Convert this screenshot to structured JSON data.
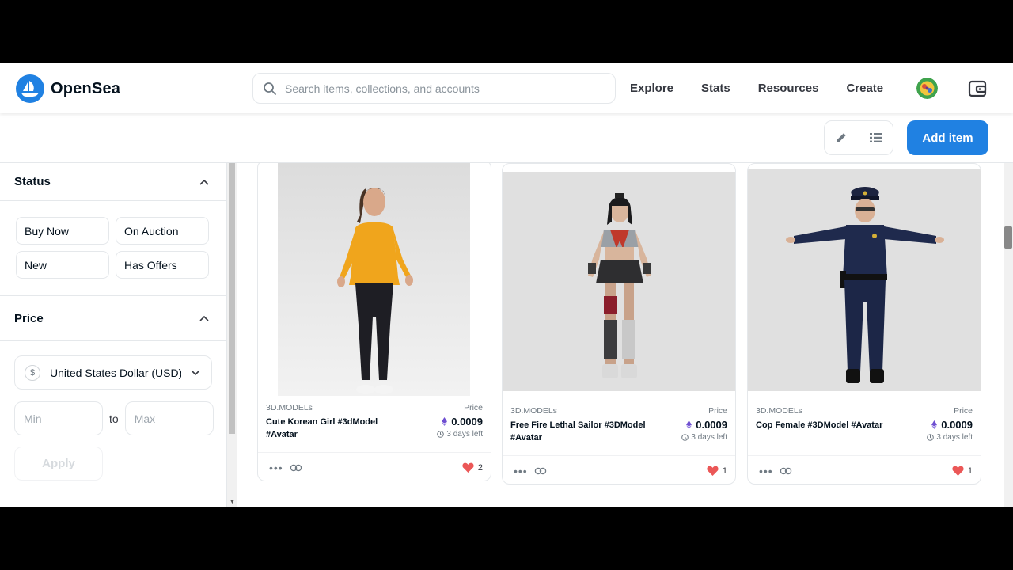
{
  "header": {
    "brand": "OpenSea",
    "search_placeholder": "Search items, collections, and accounts",
    "nav": [
      "Explore",
      "Stats",
      "Resources",
      "Create"
    ]
  },
  "actions": {
    "add_item": "Add item"
  },
  "sidebar": {
    "status_title": "Status",
    "status_options": [
      "Buy Now",
      "On Auction",
      "New",
      "Has Offers"
    ],
    "price_title": "Price",
    "currency": "United States Dollar (USD)",
    "currency_symbol": "$",
    "min_placeholder": "Min",
    "to_label": "to",
    "max_placeholder": "Max",
    "apply_label": "Apply"
  },
  "items": [
    {
      "collection": "3D.MODELs",
      "title": "Cute Korean Girl #3dModel #Avatar",
      "price_label": "Price",
      "price": "0.0009",
      "time_left": "3 days left",
      "likes": "2"
    },
    {
      "collection": "3D.MODELs",
      "title": "Free Fire Lethal Sailor #3DModel #Avatar",
      "price_label": "Price",
      "price": "0.0009",
      "time_left": "3 days left",
      "likes": "1"
    },
    {
      "collection": "3D.MODELs",
      "title": "Cop Female #3DModel #Avatar",
      "price_label": "Price",
      "price": "0.0009",
      "time_left": "3 days left",
      "likes": "1"
    }
  ],
  "colors": {
    "primary": "#2081e2",
    "heart": "#eb5757",
    "eth": "#6f4fd1"
  }
}
